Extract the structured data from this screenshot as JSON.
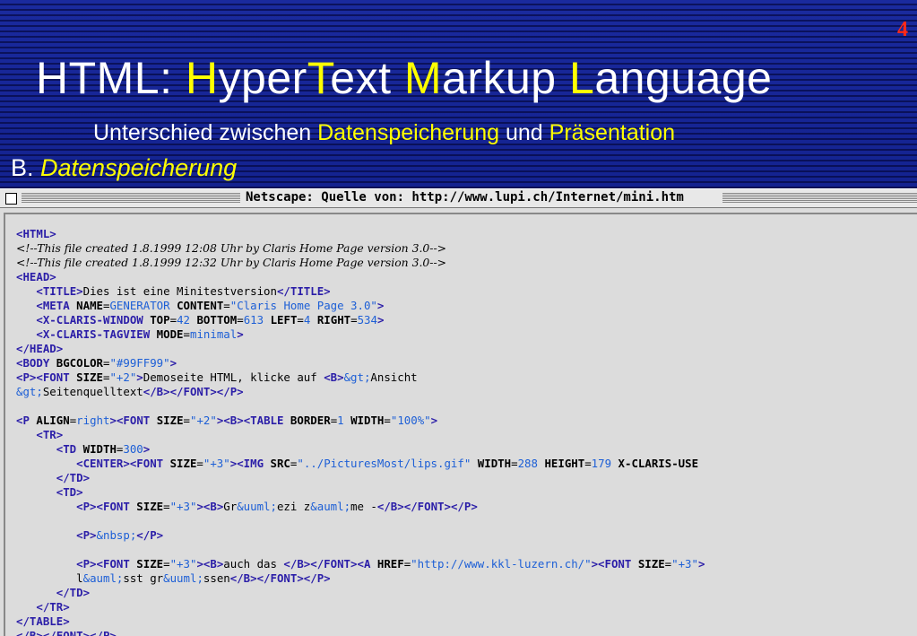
{
  "slide": {
    "page_number": "4",
    "title": [
      {
        "text": "HTML:  ",
        "hl": false
      },
      {
        "text": "H",
        "hl": true
      },
      {
        "text": "yper",
        "hl": false
      },
      {
        "text": "T",
        "hl": true
      },
      {
        "text": "ext ",
        "hl": false
      },
      {
        "text": "M",
        "hl": true
      },
      {
        "text": "arkup ",
        "hl": false
      },
      {
        "text": "L",
        "hl": true
      },
      {
        "text": "anguage",
        "hl": false
      }
    ],
    "subtitle": [
      {
        "text": "Unterschied zwischen ",
        "hl": false
      },
      {
        "text": "Datenspeicherung",
        "hl": true
      },
      {
        "text": " und ",
        "hl": false
      },
      {
        "text": "Präsentation",
        "hl": true
      }
    ],
    "section_heading": [
      {
        "text": "B. ",
        "hl": false
      },
      {
        "text": "Datenspeicherung",
        "hl": true
      }
    ]
  },
  "window": {
    "title": "Netscape: Quelle von: http://www.lupi.ch/Internet/mini.htm"
  },
  "source_lines": [
    [
      [
        "t",
        "<HTML>"
      ]
    ],
    [
      [
        "c",
        "<!--This file created 1.8.1999 12:08 Uhr by Claris Home Page version 3.0-->"
      ]
    ],
    [
      [
        "c",
        "<!--This file created 1.8.1999 12:32 Uhr by Claris Home Page version 3.0-->"
      ]
    ],
    [
      [
        "t",
        "<HEAD>"
      ]
    ],
    [
      [
        "p",
        "   "
      ],
      [
        "t",
        "<TITLE>"
      ],
      [
        "p",
        "Dies ist eine Minitestversion"
      ],
      [
        "t",
        "</TITLE>"
      ]
    ],
    [
      [
        "p",
        "   "
      ],
      [
        "t",
        "<META "
      ],
      [
        "a",
        "NAME"
      ],
      [
        "p",
        "="
      ],
      [
        "v",
        "GENERATOR"
      ],
      [
        "p",
        " "
      ],
      [
        "a",
        "CONTENT"
      ],
      [
        "p",
        "="
      ],
      [
        "v",
        "\"Claris Home Page 3.0\""
      ],
      [
        "t",
        ">"
      ]
    ],
    [
      [
        "p",
        "   "
      ],
      [
        "t",
        "<X-CLARIS-WINDOW "
      ],
      [
        "a",
        "TOP"
      ],
      [
        "p",
        "="
      ],
      [
        "v",
        "42"
      ],
      [
        "p",
        " "
      ],
      [
        "a",
        "BOTTOM"
      ],
      [
        "p",
        "="
      ],
      [
        "v",
        "613"
      ],
      [
        "p",
        " "
      ],
      [
        "a",
        "LEFT"
      ],
      [
        "p",
        "="
      ],
      [
        "v",
        "4"
      ],
      [
        "p",
        " "
      ],
      [
        "a",
        "RIGHT"
      ],
      [
        "p",
        "="
      ],
      [
        "v",
        "534"
      ],
      [
        "t",
        ">"
      ]
    ],
    [
      [
        "p",
        "   "
      ],
      [
        "t",
        "<X-CLARIS-TAGVIEW "
      ],
      [
        "a",
        "MODE"
      ],
      [
        "p",
        "="
      ],
      [
        "v",
        "minimal"
      ],
      [
        "t",
        ">"
      ]
    ],
    [
      [
        "t",
        "</HEAD>"
      ]
    ],
    [
      [
        "t",
        "<BODY "
      ],
      [
        "a",
        "BGCOLOR"
      ],
      [
        "p",
        "="
      ],
      [
        "v",
        "\"#99FF99\""
      ],
      [
        "t",
        ">"
      ]
    ],
    [
      [
        "t",
        "<P><FONT "
      ],
      [
        "a",
        "SIZE"
      ],
      [
        "p",
        "="
      ],
      [
        "v",
        "\"+2\""
      ],
      [
        "t",
        ">"
      ],
      [
        "p",
        "Demoseite HTML, klicke auf "
      ],
      [
        "t",
        "<B>"
      ],
      [
        "e",
        "&gt;"
      ],
      [
        "p",
        "Ansicht"
      ]
    ],
    [
      [
        "e",
        "&gt;"
      ],
      [
        "p",
        "Seitenquelltext"
      ],
      [
        "t",
        "</B></FONT></P>"
      ]
    ],
    [
      [
        "p",
        ""
      ]
    ],
    [
      [
        "t",
        "<P "
      ],
      [
        "a",
        "ALIGN"
      ],
      [
        "p",
        "="
      ],
      [
        "v",
        "right"
      ],
      [
        "t",
        "><FONT "
      ],
      [
        "a",
        "SIZE"
      ],
      [
        "p",
        "="
      ],
      [
        "v",
        "\"+2\""
      ],
      [
        "t",
        "><B><TABLE "
      ],
      [
        "a",
        "BORDER"
      ],
      [
        "p",
        "="
      ],
      [
        "v",
        "1"
      ],
      [
        "p",
        " "
      ],
      [
        "a",
        "WIDTH"
      ],
      [
        "p",
        "="
      ],
      [
        "v",
        "\"100%\""
      ],
      [
        "t",
        ">"
      ]
    ],
    [
      [
        "p",
        "   "
      ],
      [
        "t",
        "<TR>"
      ]
    ],
    [
      [
        "p",
        "      "
      ],
      [
        "t",
        "<TD "
      ],
      [
        "a",
        "WIDTH"
      ],
      [
        "p",
        "="
      ],
      [
        "v",
        "300"
      ],
      [
        "t",
        ">"
      ]
    ],
    [
      [
        "p",
        "         "
      ],
      [
        "t",
        "<CENTER><FONT "
      ],
      [
        "a",
        "SIZE"
      ],
      [
        "p",
        "="
      ],
      [
        "v",
        "\"+3\""
      ],
      [
        "t",
        "><IMG "
      ],
      [
        "a",
        "SRC"
      ],
      [
        "p",
        "="
      ],
      [
        "v",
        "\"../PicturesMost/lips.gif\""
      ],
      [
        "p",
        " "
      ],
      [
        "a",
        "WIDTH"
      ],
      [
        "p",
        "="
      ],
      [
        "v",
        "288"
      ],
      [
        "p",
        " "
      ],
      [
        "a",
        "HEIGHT"
      ],
      [
        "p",
        "="
      ],
      [
        "v",
        "179"
      ],
      [
        "p",
        " "
      ],
      [
        "a",
        "X-CLARIS-USE"
      ]
    ],
    [
      [
        "p",
        "      "
      ],
      [
        "t",
        "</TD>"
      ]
    ],
    [
      [
        "p",
        "      "
      ],
      [
        "t",
        "<TD>"
      ]
    ],
    [
      [
        "p",
        "         "
      ],
      [
        "t",
        "<P><FONT "
      ],
      [
        "a",
        "SIZE"
      ],
      [
        "p",
        "="
      ],
      [
        "v",
        "\"+3\""
      ],
      [
        "t",
        "><B>"
      ],
      [
        "p",
        "Gr"
      ],
      [
        "e",
        "&uuml;"
      ],
      [
        "p",
        "ezi z"
      ],
      [
        "e",
        "&auml;"
      ],
      [
        "p",
        "me -"
      ],
      [
        "t",
        "</B></FONT></P>"
      ]
    ],
    [
      [
        "p",
        ""
      ]
    ],
    [
      [
        "p",
        "         "
      ],
      [
        "t",
        "<P>"
      ],
      [
        "e",
        "&nbsp;"
      ],
      [
        "t",
        "</P>"
      ]
    ],
    [
      [
        "p",
        ""
      ]
    ],
    [
      [
        "p",
        "         "
      ],
      [
        "t",
        "<P><FONT "
      ],
      [
        "a",
        "SIZE"
      ],
      [
        "p",
        "="
      ],
      [
        "v",
        "\"+3\""
      ],
      [
        "t",
        "><B>"
      ],
      [
        "p",
        "auch das "
      ],
      [
        "t",
        "</B></FONT><A "
      ],
      [
        "a",
        "HREF"
      ],
      [
        "p",
        "="
      ],
      [
        "v",
        "\"http://www.kkl-luzern.ch/\""
      ],
      [
        "t",
        "><FONT "
      ],
      [
        "a",
        "SIZE"
      ],
      [
        "p",
        "="
      ],
      [
        "v",
        "\"+3\""
      ],
      [
        "t",
        ">"
      ]
    ],
    [
      [
        "p",
        "         l"
      ],
      [
        "e",
        "&auml;"
      ],
      [
        "p",
        "sst gr"
      ],
      [
        "e",
        "&uuml;"
      ],
      [
        "p",
        "ssen"
      ],
      [
        "t",
        "</B></FONT></P>"
      ]
    ],
    [
      [
        "p",
        "      "
      ],
      [
        "t",
        "</TD>"
      ]
    ],
    [
      [
        "p",
        "   "
      ],
      [
        "t",
        "</TR>"
      ]
    ],
    [
      [
        "t",
        "</TABLE>"
      ]
    ],
    [
      [
        "t",
        "</B></FONT></P>"
      ]
    ]
  ]
}
